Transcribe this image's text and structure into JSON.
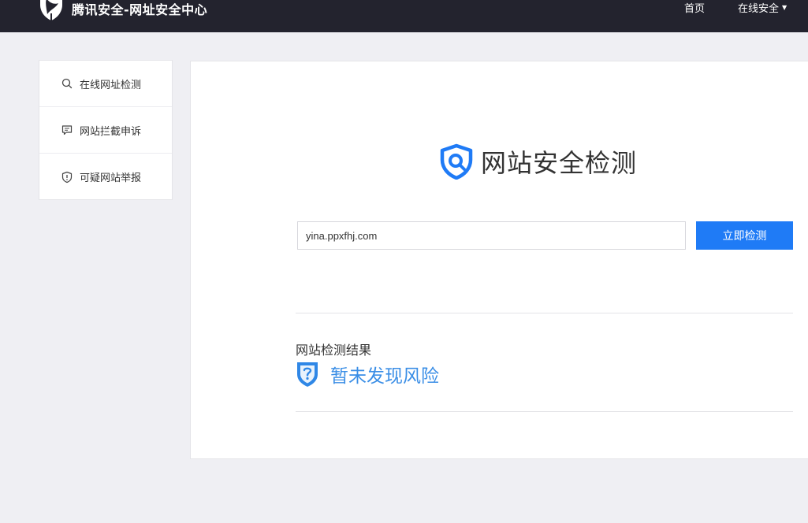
{
  "header": {
    "brand_title": "腾讯安全-网址安全中心",
    "logo_icon": "tencent-security-shield-icon",
    "nav": {
      "home": "首页",
      "online_security": "在线安全",
      "caret": "▼"
    }
  },
  "sidebar": {
    "items": [
      {
        "label": "在线网址检测",
        "icon": "search-icon"
      },
      {
        "label": "网站拦截申诉",
        "icon": "comment-icon"
      },
      {
        "label": "可疑网站举报",
        "icon": "shield-alert-icon"
      }
    ]
  },
  "main": {
    "title": "网站安全检测",
    "title_icon": "shield-search-icon",
    "url_input_value": "yina.ppxfhj.com",
    "detect_button": "立即检测",
    "result_label": "网站检测结果",
    "result_status": "暂未发现风险",
    "result_icon": "unknown-shield-icon"
  },
  "colors": {
    "header_bg": "#23232e",
    "page_bg": "#efeff3",
    "accent": "#1f7bf6",
    "result_text": "#3a8ee6"
  }
}
